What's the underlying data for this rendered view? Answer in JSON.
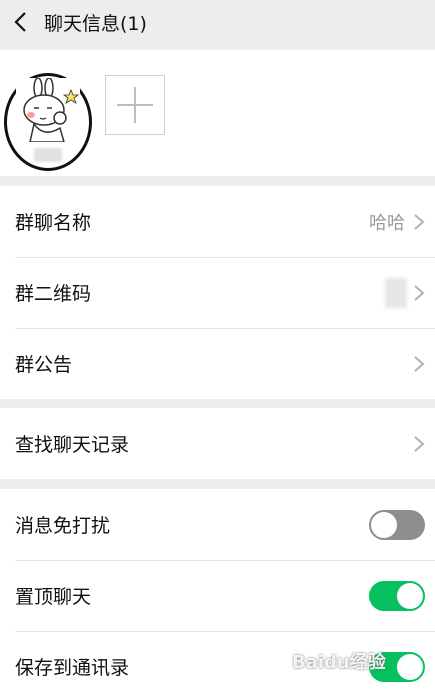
{
  "header": {
    "title": "聊天信息(1)"
  },
  "members": {
    "add_icon": "plus-icon"
  },
  "group_info": [
    {
      "label": "群聊名称",
      "value": "哈哈"
    },
    {
      "label": "群二维码"
    },
    {
      "label": "群公告"
    }
  ],
  "search": {
    "label": "查找聊天记录"
  },
  "settings": [
    {
      "label": "消息免打扰",
      "on": false
    },
    {
      "label": "置顶聊天",
      "on": true
    },
    {
      "label": "保存到通讯录",
      "on": true
    }
  ],
  "colors": {
    "accent": "#07c160",
    "toggle_off": "#8e8e8e",
    "background": "#ededed"
  },
  "watermark": {
    "text": "Baidu经验"
  }
}
